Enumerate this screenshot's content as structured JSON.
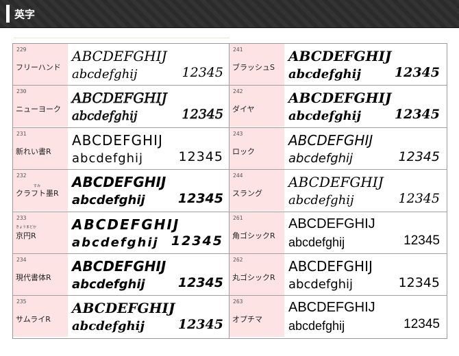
{
  "header": {
    "title": "英字"
  },
  "fonts": [
    {
      "num": "229",
      "name": "フリーハンド",
      "upper": "ABCDEFGHIJ",
      "lower": "abcdefghij",
      "digits": "12345"
    },
    {
      "num": "230",
      "name": "ニューヨーク",
      "upper": "ABCDEFGHIJ",
      "lower": "abcdefghij",
      "digits": "12345"
    },
    {
      "num": "231",
      "name": "新れい書R",
      "upper": "ABCDEFGHIJ",
      "lower": "abcdefghij",
      "digits": "12345"
    },
    {
      "num": "232",
      "name": "クラフト墨R",
      "ruby": "すみ",
      "upper": "ABCDEFGHIJ",
      "lower": "abcdefghij",
      "digits": "12345"
    },
    {
      "num": "233",
      "name": "京円R",
      "ruby": "きょうまどか",
      "upper": "ABCDEFGHIJ",
      "lower": "abcdefghij",
      "digits": "12345"
    },
    {
      "num": "234",
      "name": "現代書体R",
      "upper": "ABCDEFGHIJ",
      "lower": "abcdefghij",
      "digits": "12345"
    },
    {
      "num": "235",
      "name": "サムライR",
      "upper": "ABCDEFGHIJ",
      "lower": "abcdefghij",
      "digits": "12345"
    },
    {
      "num": "241",
      "name": "ブラッシュS",
      "upper": "ABCDEFGHIJ",
      "lower": "abcdefghij",
      "digits": "12345"
    },
    {
      "num": "242",
      "name": "ダイヤ",
      "upper": "ABCDEFGHIJ",
      "lower": "abcdefghij",
      "digits": "12345"
    },
    {
      "num": "243",
      "name": "ロック",
      "upper": "ABCDEFGHIJ",
      "lower": "abcdefghij",
      "digits": "12345"
    },
    {
      "num": "244",
      "name": "スラング",
      "upper": "ABCDEFGHIJ",
      "lower": "abcdefghij",
      "digits": "12345"
    },
    {
      "num": "261",
      "name": "角ゴシックR",
      "upper": "ABCDEFGHIJ",
      "lower": "abcdefghij",
      "digits": "12345"
    },
    {
      "num": "262",
      "name": "丸ゴシックR",
      "upper": "ABCDEFGHIJ",
      "lower": "abcdefghij",
      "digits": "12345"
    },
    {
      "num": "263",
      "name": "オプチマ",
      "upper": "ABCDEFGHIJ",
      "lower": "abcdefghij",
      "digits": "12345"
    }
  ]
}
